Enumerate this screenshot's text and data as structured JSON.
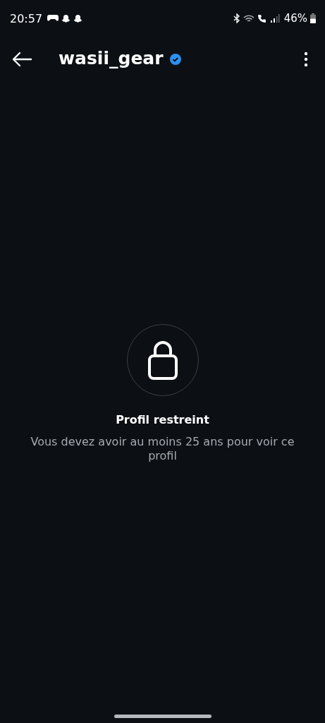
{
  "status_bar": {
    "time": "20:57",
    "battery": "46%"
  },
  "header": {
    "username": "wasii_gear",
    "verified": true
  },
  "restricted": {
    "title": "Profil restreint",
    "message": "Vous devez avoir au moins 25 ans pour voir ce profil"
  }
}
